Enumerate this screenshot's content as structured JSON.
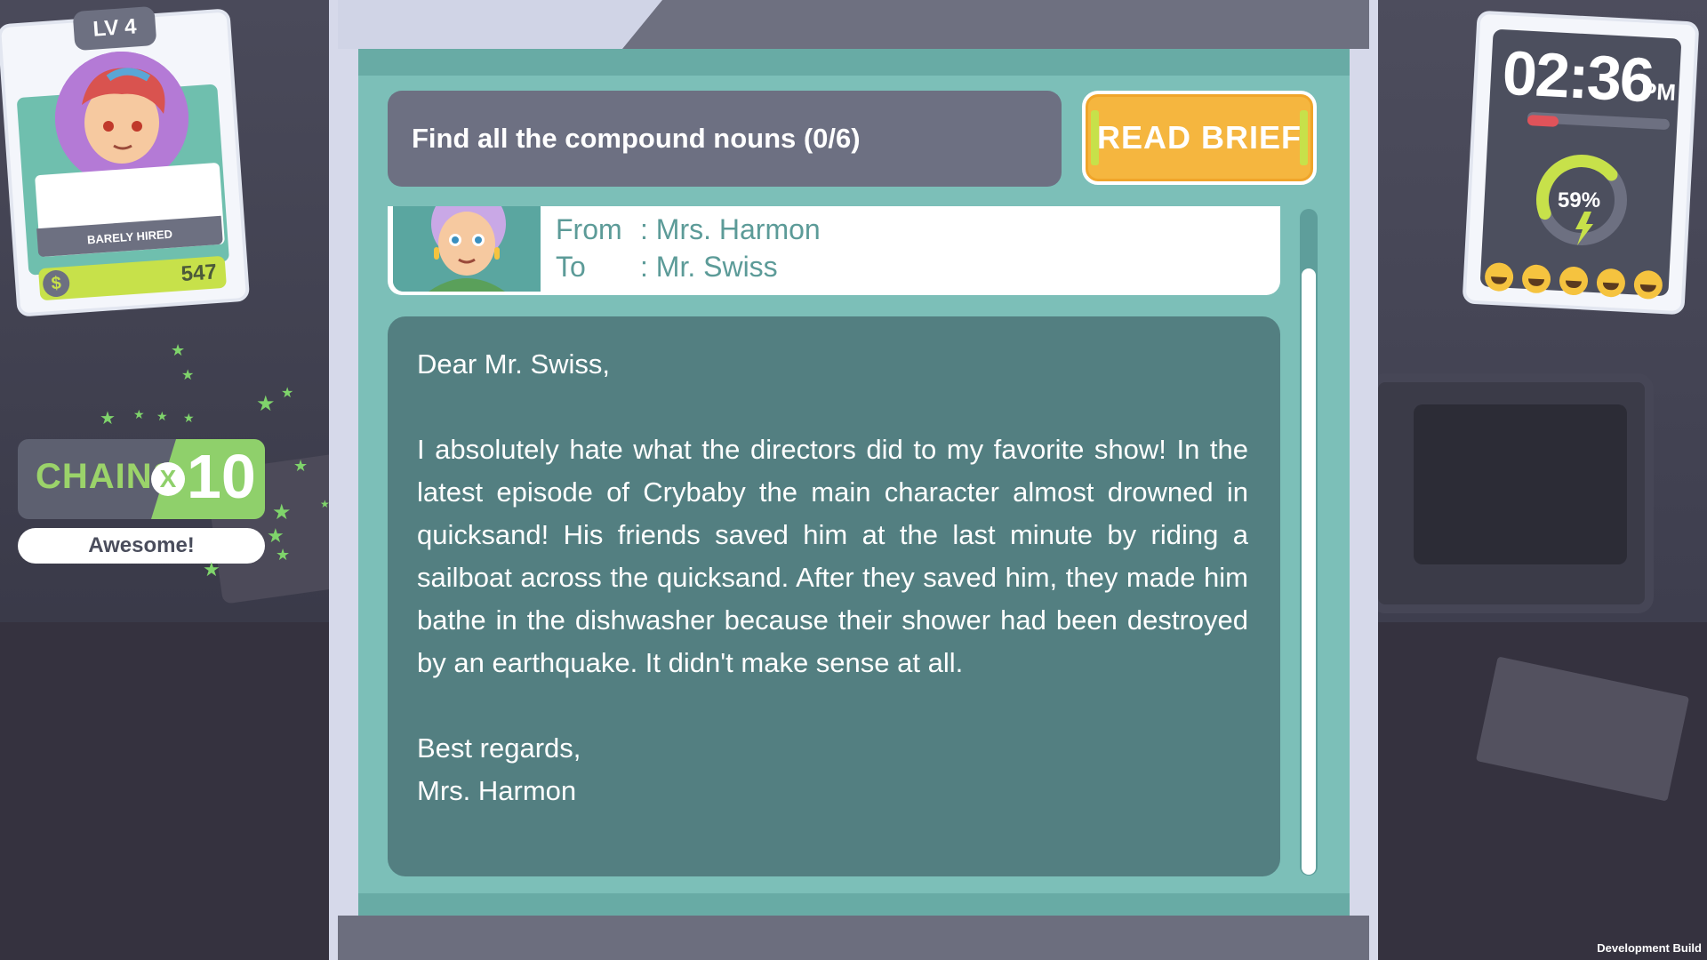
{
  "objective": {
    "text": "Find all the compound nouns (0/6)"
  },
  "brief_button": {
    "label": "READ BRIEF"
  },
  "email": {
    "from_label": "From",
    "from_value": ": Mrs. Harmon",
    "to_label": "To",
    "to_value": ": Mr. Swiss",
    "greeting": "Dear Mr. Swiss,",
    "body": "I absolutely hate what the directors did to my favorite show! In the latest episode of Crybaby the main character almost drowned in quicksand! His friends saved him at the last minute by riding a sailboat across the quicksand. After they saved him, they made him bathe in the dishwasher because their shower had been destroyed by an earthquake. It didn't make sense at all.",
    "closing": "Best regards,",
    "signature": "Mrs. Harmon"
  },
  "player": {
    "level": "LV 4",
    "rank": "BARELY HIRED",
    "money": "547",
    "money_icon": "dollar-coin-icon"
  },
  "chains": {
    "label": "CHAINS",
    "multiplier_symbol": "X",
    "value": "10",
    "feedback": "Awesome!"
  },
  "timer": {
    "time": "02:36",
    "period": "PM",
    "progress_fraction": 0.22,
    "energy_percent": 59,
    "energy_label": "59%",
    "mood_count": 5
  },
  "footer": {
    "build_label": "Development Build"
  },
  "colors": {
    "panel_teal": "#68aba5",
    "letter_bg": "#537f81",
    "brief_orange": "#f5b63f",
    "accent_green": "#8fd06b",
    "objective_grey": "#6d7082"
  }
}
